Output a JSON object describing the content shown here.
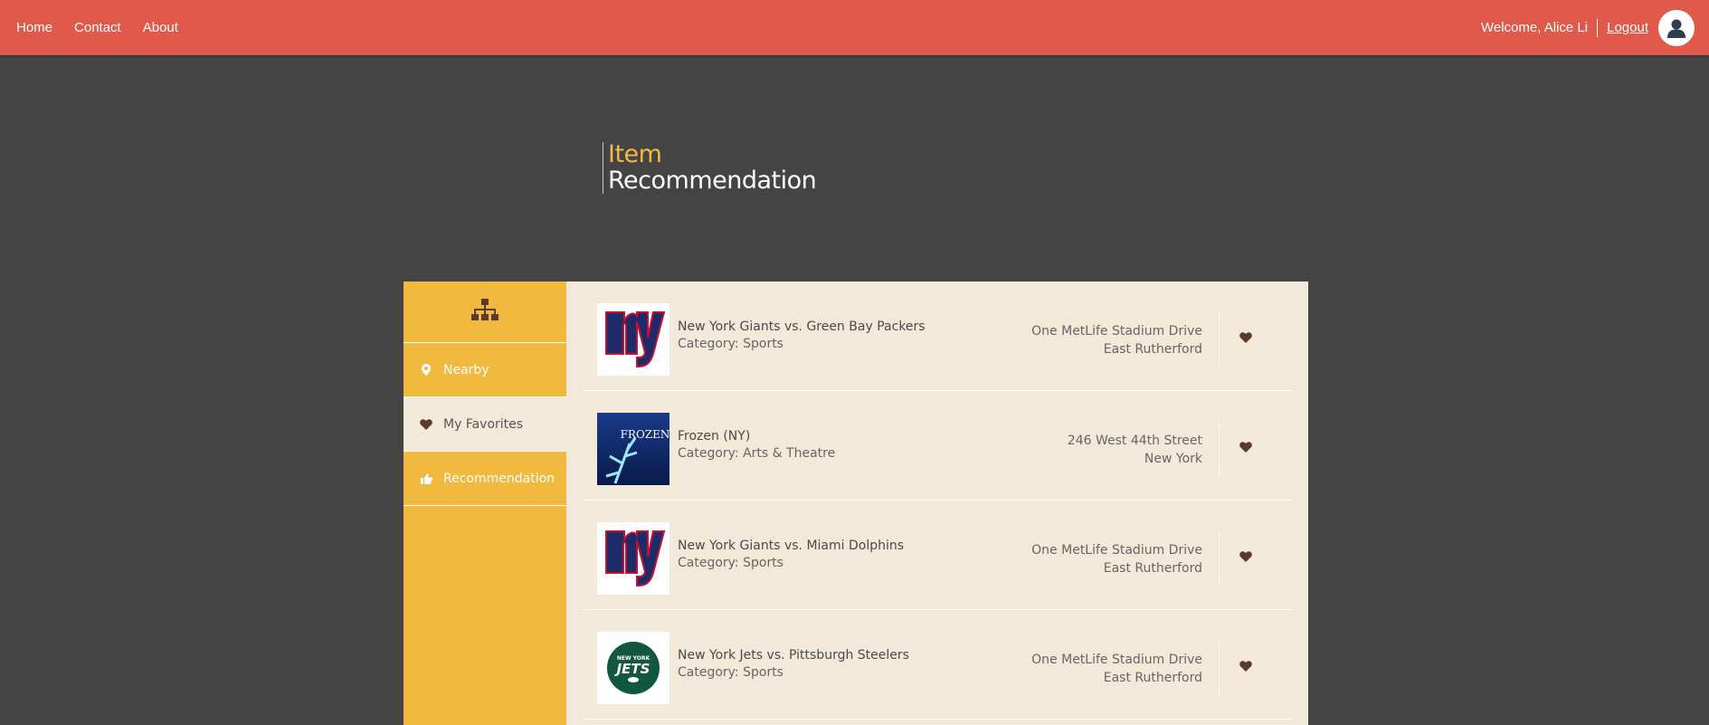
{
  "nav": {
    "links": [
      "Home",
      "Contact",
      "About"
    ],
    "welcome": "Welcome, Alice Li",
    "logout": "Logout",
    "avatar_icon": "user-avatar-icon"
  },
  "title": {
    "line1": "Item",
    "line2": "Recommendation"
  },
  "sidebar": {
    "top_icon": "sitemap-icon",
    "items": [
      {
        "label": "Nearby",
        "icon": "map-marker-icon",
        "active": false
      },
      {
        "label": "My Favorites",
        "icon": "heart-icon",
        "active": true
      },
      {
        "label": "Recommendation",
        "icon": "thumbs-up-icon",
        "active": false
      }
    ]
  },
  "items": [
    {
      "name": "New York Giants vs. Green Bay Packers",
      "category": "Category: Sports",
      "address1": "One MetLife Stadium Drive",
      "address2": "East Rutherford",
      "logo": "ny"
    },
    {
      "name": "Frozen (NY)",
      "category": "Category: Arts & Theatre",
      "address1": "246 West 44th Street",
      "address2": "New York",
      "logo": "frozen"
    },
    {
      "name": "New York Giants vs. Miami Dolphins",
      "category": "Category: Sports",
      "address1": "One MetLife Stadium Drive",
      "address2": "East Rutherford",
      "logo": "ny"
    },
    {
      "name": "New York Jets vs. Pittsburgh Steelers",
      "category": "Category: Sports",
      "address1": "One MetLife Stadium Drive",
      "address2": "East Rutherford",
      "logo": "jets"
    }
  ],
  "logos": {
    "frozen_text": "FROZEN",
    "jets_top": "NEW YORK",
    "jets_main": "JETS"
  },
  "colors": {
    "nav": "#e0594b",
    "background": "#444444",
    "accent": "#f2b93f",
    "panel": "#f2e9d8",
    "icon": "#5a3b2a"
  }
}
